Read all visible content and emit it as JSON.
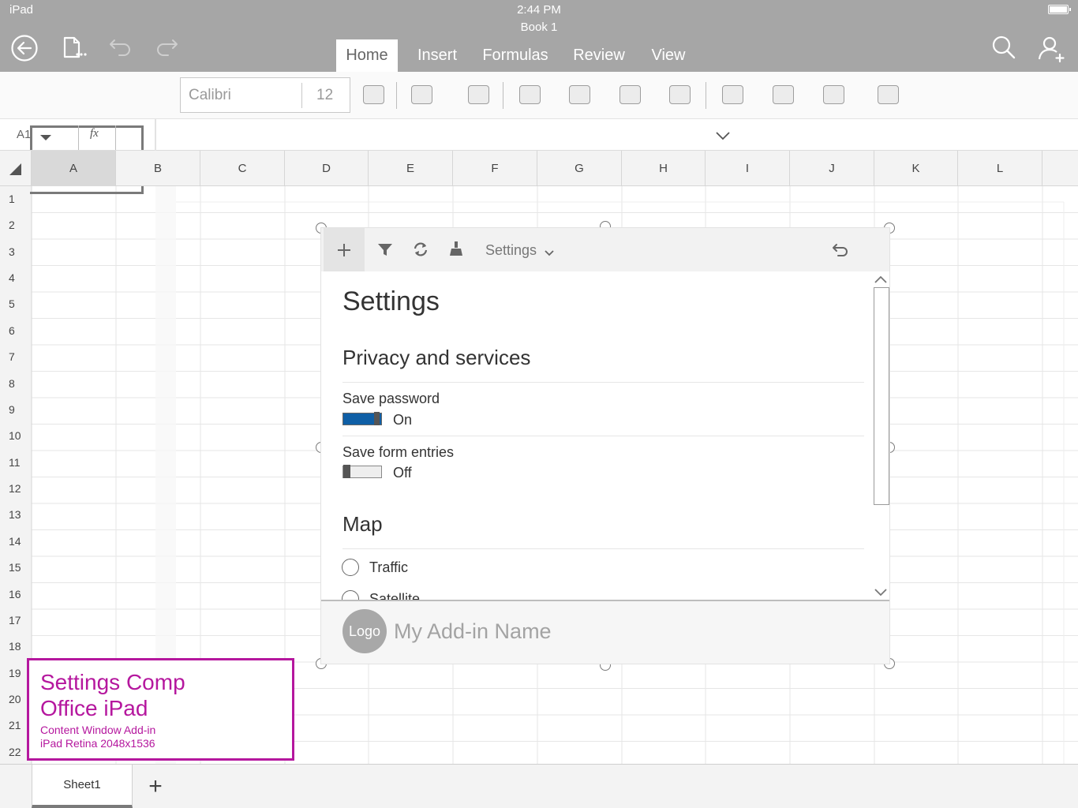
{
  "status": {
    "device": "iPad",
    "time": "2:44 PM"
  },
  "document": {
    "title": "Book 1"
  },
  "tabs": [
    {
      "label": "Home",
      "active": true
    },
    {
      "label": "Insert",
      "active": false
    },
    {
      "label": "Formulas",
      "active": false
    },
    {
      "label": "Review",
      "active": false
    },
    {
      "label": "View",
      "active": false
    }
  ],
  "ribbon": {
    "font_name": "Calibri",
    "font_size": "12"
  },
  "formula_bar": {
    "name_box": "A1",
    "fx": "fx",
    "value": ""
  },
  "grid": {
    "columns": [
      "A",
      "B",
      "C",
      "D",
      "E",
      "F",
      "G",
      "H",
      "I",
      "J",
      "K",
      "L"
    ],
    "rows": [
      "1",
      "2",
      "3",
      "4",
      "5",
      "6",
      "7",
      "8",
      "9",
      "10",
      "11",
      "12",
      "13",
      "14",
      "15",
      "16",
      "17",
      "18",
      "19",
      "20",
      "21",
      "22"
    ],
    "selected_cell": "A1"
  },
  "addin": {
    "toolbar": {
      "menu_label": "Settings"
    },
    "page_title": "Settings",
    "privacy": {
      "heading": "Privacy and services",
      "save_password": {
        "label": "Save password",
        "state": "On",
        "on": true
      },
      "save_form": {
        "label": "Save form entries",
        "state": "Off",
        "on": false
      }
    },
    "map": {
      "heading": "Map",
      "options": [
        "Traffic",
        "Satellite"
      ]
    },
    "footer": {
      "logo": "Logo",
      "name": "My Add-in Name"
    }
  },
  "comp_label": {
    "line1": "Settings Comp",
    "line2": "Office iPad",
    "line3": "Content Window Add-in",
    "line4": "iPad Retina 2048x1536",
    "color": "#b5179e"
  },
  "sheets": {
    "tabs": [
      "Sheet1"
    ],
    "add_label": "+"
  },
  "colors": {
    "topbar": "#a6a6a6",
    "toggle_on": "#0f5fa6",
    "accent": "#b5179e"
  }
}
